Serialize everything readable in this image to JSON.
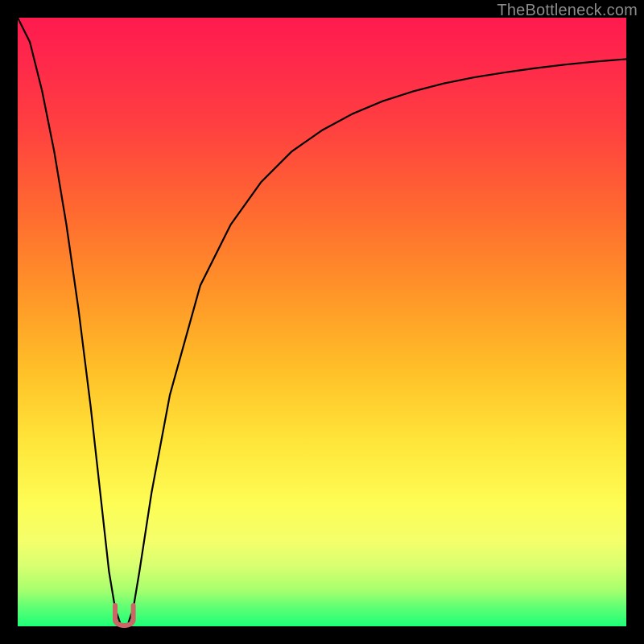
{
  "watermark": {
    "text": "TheBottleneck.com"
  },
  "colors": {
    "frame": "#000000",
    "curve_stroke": "#000000",
    "nub_fill": "#cc6666",
    "nub_stroke": "#a14545"
  },
  "chart_data": {
    "type": "line",
    "title": "",
    "xlabel": "",
    "ylabel": "",
    "xlim": [
      0,
      100
    ],
    "ylim": [
      0,
      100
    ],
    "grid": false,
    "series": [
      {
        "name": "bottleneck-curve",
        "x": [
          0,
          2,
          4,
          6,
          8,
          10,
          12,
          14,
          15,
          16,
          17,
          18,
          19,
          20,
          22,
          25,
          30,
          35,
          40,
          45,
          50,
          55,
          60,
          65,
          70,
          75,
          80,
          85,
          90,
          95,
          100
        ],
        "values": [
          100,
          96,
          88,
          78,
          66,
          52,
          36,
          18,
          9,
          3,
          0,
          0,
          3,
          9,
          22,
          38,
          56,
          66,
          73,
          78,
          81.5,
          84.2,
          86.3,
          87.9,
          89.2,
          90.2,
          91.0,
          91.7,
          92.3,
          92.8,
          93.2
        ]
      }
    ],
    "annotations": [
      {
        "name": "nub-marker",
        "x_range": [
          16,
          19
        ],
        "y": 0
      }
    ]
  }
}
